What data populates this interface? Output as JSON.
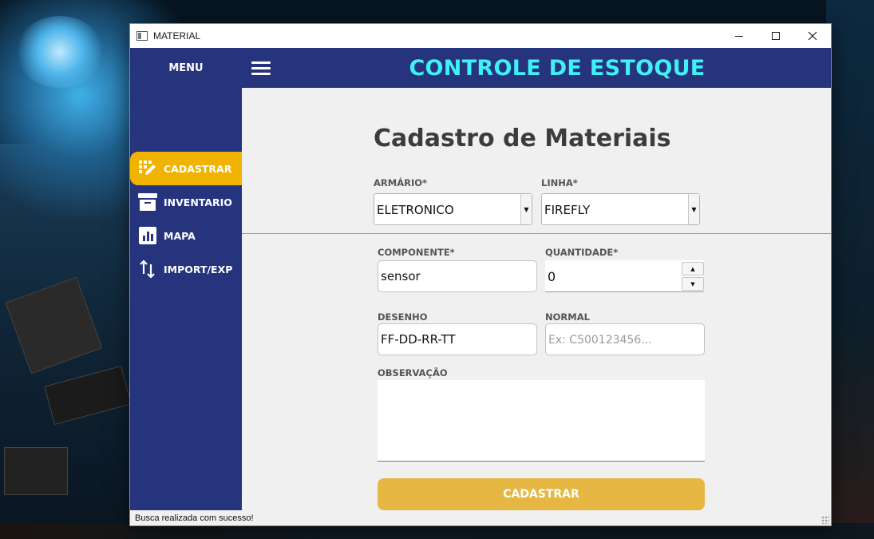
{
  "window": {
    "title": "MATERIAL"
  },
  "header": {
    "menu_label": "MENU",
    "app_title": "CONTROLE DE ESTOQUE"
  },
  "sidebar": {
    "items": [
      {
        "label": "CADASTRAR",
        "icon": "edit-grid-icon",
        "active": true
      },
      {
        "label": "INVENTARIO",
        "icon": "archive-box-icon",
        "active": false
      },
      {
        "label": "MAPA",
        "icon": "bar-chart-icon",
        "active": false
      },
      {
        "label": "IMPORT/EXP",
        "icon": "up-down-arrows-icon",
        "active": false
      }
    ]
  },
  "form": {
    "title": "Cadastro de Materiais",
    "armario": {
      "label": "ARMÁRIO*",
      "value": "ELETRONICO"
    },
    "linha": {
      "label": "LINHA*",
      "value": "FIREFLY"
    },
    "componente": {
      "label": "COMPONENTE*",
      "value": "sensor"
    },
    "quantidade": {
      "label": "QUANTIDADE*",
      "value": "0"
    },
    "desenho": {
      "label": "DESENHO",
      "value": "FF-DD-RR-TT"
    },
    "normal": {
      "label": "NORMAL",
      "placeholder": "Ex: C500123456..."
    },
    "observacao": {
      "label": "OBSERVAÇÃO",
      "value": ""
    },
    "submit_label": "CADASTRAR"
  },
  "status": {
    "message": "Busca realizada com sucesso!"
  },
  "colors": {
    "nav_bg": "#25347c",
    "active_item": "#f0b400",
    "title_cyan": "#3ff0f5",
    "submit_button": "#e6b843"
  }
}
